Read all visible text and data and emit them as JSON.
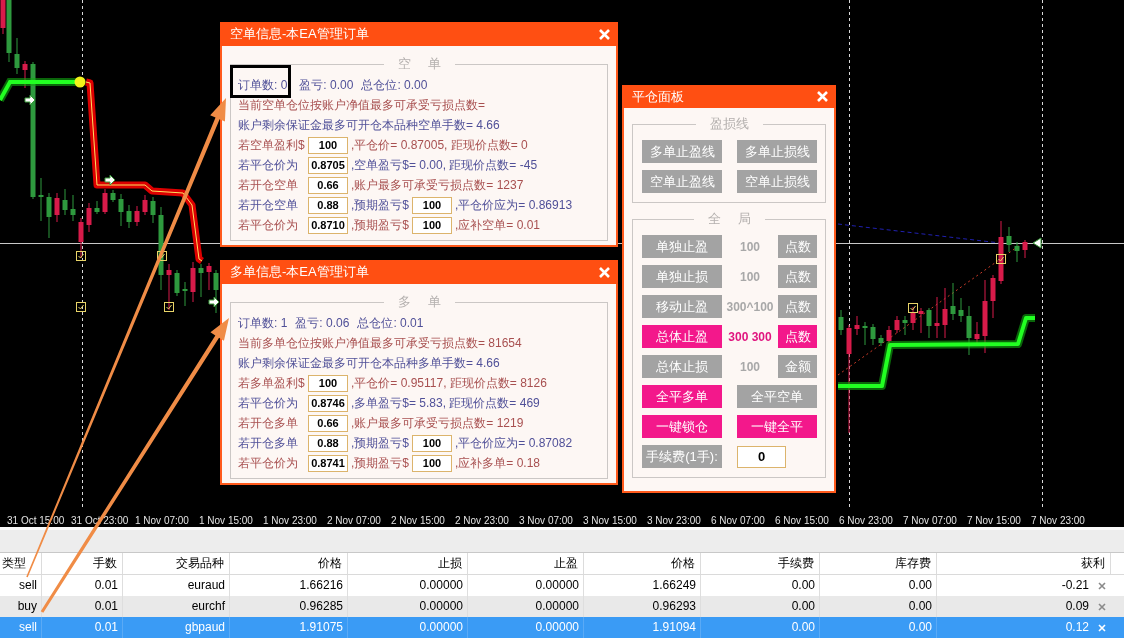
{
  "chart": {
    "time_labels": [
      "31 Oct 15:00",
      "31 Oct 23:00",
      "1 Nov 07:00",
      "1 Nov 15:00",
      "1 Nov 23:00",
      "2 Nov 07:00",
      "2 Nov 15:00",
      "2 Nov 23:00",
      "3 Nov 07:00",
      "3 Nov 15:00",
      "3 Nov 23:00",
      "6 Nov 07:00",
      "6 Nov 15:00",
      "6 Nov 23:00",
      "7 Nov 07:00",
      "7 Nov 15:00",
      "7 Nov 23:00"
    ]
  },
  "info_panels": [
    {
      "title": "空单信息-本EA管理订单",
      "legend": "空 单",
      "summary": [
        {
          "text": "订单数: 0",
          "highlighted": true
        },
        {
          "text": "盈亏: 0.00",
          "highlighted": false
        },
        {
          "text": "总仓位: 0.00",
          "highlighted": false
        }
      ],
      "lines": [
        {
          "color": "#a85050",
          "segments": [
            {
              "kind": "text",
              "text": "当前空单仓位按账户净值最多可承受亏损点数="
            }
          ]
        },
        {
          "color": "#505098",
          "segments": [
            {
              "kind": "text",
              "text": "账户剩余保证金最多可开仓本品种空单手数= 4.66"
            }
          ]
        },
        {
          "color": "#a85050",
          "segments": [
            {
              "kind": "text",
              "text": "若空单盈利$"
            },
            {
              "kind": "input",
              "value": "100"
            },
            {
              "kind": "text",
              "text": ",平仓价= 0.87005, 距现价点数= 0"
            }
          ]
        },
        {
          "color": "#505098",
          "segments": [
            {
              "kind": "text",
              "text": "若平仓价为"
            },
            {
              "kind": "input",
              "value": "0.8705"
            },
            {
              "kind": "text",
              "text": ",空单盈亏$= 0.00, 距现价点数= -45"
            }
          ]
        },
        {
          "color": "#a85050",
          "segments": [
            {
              "kind": "text",
              "text": "若开仓空单"
            },
            {
              "kind": "input",
              "value": "0.66"
            },
            {
              "kind": "text",
              "text": ",账户最多可承受亏损点数= 1237"
            }
          ]
        },
        {
          "color": "#505098",
          "segments": [
            {
              "kind": "text",
              "text": "若开仓空单"
            },
            {
              "kind": "input",
              "value": "0.88"
            },
            {
              "kind": "text",
              "text": ",预期盈亏$"
            },
            {
              "kind": "input",
              "value": "100"
            },
            {
              "kind": "text",
              "text": ",平仓价应为= 0.86913"
            }
          ]
        },
        {
          "color": "#a85050",
          "segments": [
            {
              "kind": "text",
              "text": "若平仓价为"
            },
            {
              "kind": "input",
              "value": "0.8710"
            },
            {
              "kind": "text",
              "text": ",预期盈亏$"
            },
            {
              "kind": "input",
              "value": "100"
            },
            {
              "kind": "text",
              "text": ",应补空单= 0.01"
            }
          ]
        }
      ]
    },
    {
      "title": "多单信息-本EA管理订单",
      "legend": "多 单",
      "summary": [
        {
          "text": "订单数: 1",
          "highlighted": false
        },
        {
          "text": "盈亏: 0.06",
          "highlighted": false
        },
        {
          "text": "总仓位: 0.01",
          "highlighted": false
        }
      ],
      "lines": [
        {
          "color": "#a85050",
          "segments": [
            {
              "kind": "text",
              "text": "当前多单仓位按账户净值最多可承受亏损点数= 81654"
            }
          ]
        },
        {
          "color": "#505098",
          "segments": [
            {
              "kind": "text",
              "text": "账户剩余保证金最多可开仓本品种多单手数= 4.66"
            }
          ]
        },
        {
          "color": "#a85050",
          "segments": [
            {
              "kind": "text",
              "text": "若多单盈利$"
            },
            {
              "kind": "input",
              "value": "100"
            },
            {
              "kind": "text",
              "text": ",平仓价= 0.95117, 距现价点数= 8126"
            }
          ]
        },
        {
          "color": "#505098",
          "segments": [
            {
              "kind": "text",
              "text": "若平仓价为"
            },
            {
              "kind": "input",
              "value": "0.8746"
            },
            {
              "kind": "text",
              "text": ",多单盈亏$= 5.83, 距现价点数= 469"
            }
          ]
        },
        {
          "color": "#a85050",
          "segments": [
            {
              "kind": "text",
              "text": "若开仓多单"
            },
            {
              "kind": "input",
              "value": "0.66"
            },
            {
              "kind": "text",
              "text": ",账户最多可承受亏损点数= 1219"
            }
          ]
        },
        {
          "color": "#505098",
          "segments": [
            {
              "kind": "text",
              "text": "若开仓多单"
            },
            {
              "kind": "input",
              "value": "0.88"
            },
            {
              "kind": "text",
              "text": ",预期盈亏$"
            },
            {
              "kind": "input",
              "value": "100"
            },
            {
              "kind": "text",
              "text": ",平仓价应为= 0.87082"
            }
          ]
        },
        {
          "color": "#a85050",
          "segments": [
            {
              "kind": "text",
              "text": "若平仓价为"
            },
            {
              "kind": "input",
              "value": "0.8741"
            },
            {
              "kind": "text",
              "text": ",预期盈亏$"
            },
            {
              "kind": "input",
              "value": "100"
            },
            {
              "kind": "text",
              "text": ",应补多单= 0.18"
            }
          ]
        }
      ]
    }
  ],
  "close_panel": {
    "title": "平仓面板",
    "groups": [
      {
        "legend": "盈损线",
        "rows": [
          {
            "kind": "pair",
            "buttons": [
              {
                "label": "多单止盈线",
                "on": false
              },
              {
                "label": "多单止损线",
                "on": false
              }
            ]
          },
          {
            "kind": "pair",
            "buttons": [
              {
                "label": "空单止盈线",
                "on": false
              },
              {
                "label": "空单止损线",
                "on": false
              }
            ]
          }
        ]
      },
      {
        "legend": "全 局",
        "rows": [
          {
            "kind": "setting",
            "label": "单独止盈",
            "value": "100",
            "unit": "点数",
            "on": false
          },
          {
            "kind": "setting",
            "label": "单独止损",
            "value": "100",
            "unit": "点数",
            "on": false
          },
          {
            "kind": "setting",
            "label": "移动止盈",
            "value": "300^100",
            "unit": "点数",
            "on": false
          },
          {
            "kind": "setting",
            "label": "总体止盈",
            "value": "300 300",
            "unit": "点数",
            "on": true
          },
          {
            "kind": "setting",
            "label": "总体止损",
            "value": "100",
            "unit": "金额",
            "on": false
          },
          {
            "kind": "pair",
            "buttons": [
              {
                "label": "全平多单",
                "on": true
              },
              {
                "label": "全平空单",
                "on": false
              }
            ]
          },
          {
            "kind": "pair",
            "buttons": [
              {
                "label": "一键锁仓",
                "on": true
              },
              {
                "label": "一键全平",
                "on": true
              }
            ]
          },
          {
            "kind": "fee",
            "label": "手续费(1手):",
            "value": "0"
          }
        ]
      }
    ]
  },
  "table": {
    "columns": [
      "类型",
      "手数",
      "交易品种",
      "价格",
      "止损",
      "止盈",
      "价格",
      "手续费",
      "库存费",
      "获利"
    ],
    "rows": [
      {
        "cells": [
          "sell",
          "0.01",
          "euraud",
          "1.66216",
          "0.00000",
          "0.00000",
          "1.66249",
          "0.00",
          "0.00",
          "-0.21"
        ],
        "selected": false
      },
      {
        "cells": [
          "buy",
          "0.01",
          "eurchf",
          "0.96285",
          "0.00000",
          "0.00000",
          "0.96293",
          "0.00",
          "0.00",
          "0.09"
        ],
        "selected": false
      },
      {
        "cells": [
          "sell",
          "0.01",
          "gbpaud",
          "1.91075",
          "0.00000",
          "0.00000",
          "1.91094",
          "0.00",
          "0.00",
          "0.12"
        ],
        "selected": true
      }
    ]
  }
}
